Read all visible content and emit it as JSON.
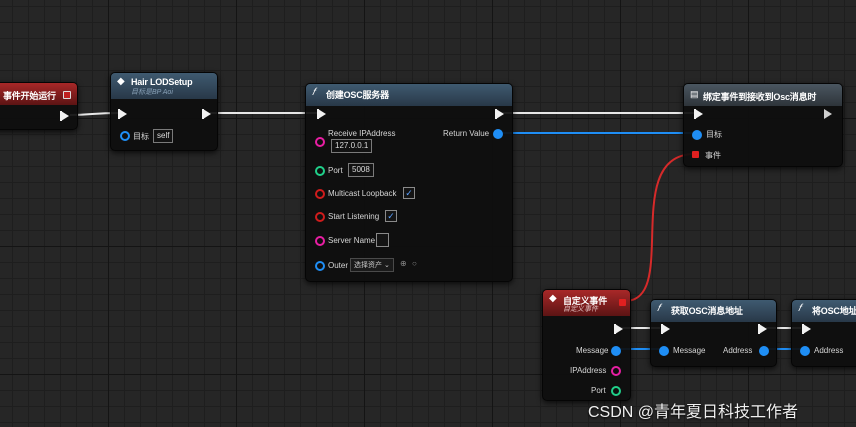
{
  "nodes": {
    "begin_play": {
      "title": "事件开始运行"
    },
    "hair_lod": {
      "title": "Hair LODSetup",
      "subtitle": "目标是BP Aoi",
      "target_label": "目标",
      "target_value": "self"
    },
    "create_osc": {
      "title": "创建OSC服务器",
      "receive_ip_label": "Receive IPAddress",
      "receive_ip_value": "127.0.0.1",
      "port_label": "Port",
      "port_value": "5008",
      "multicast_label": "Multicast Loopback",
      "multicast_checked": "✓",
      "start_listening_label": "Start Listening",
      "start_listening_checked": "✓",
      "server_name_label": "Server Name",
      "outer_label": "Outer",
      "outer_value": "选择资产",
      "return_label": "Return Value"
    },
    "bind_event": {
      "title": "绑定事件到接收到Osc消息时",
      "target_label": "目标",
      "event_label": "事件"
    },
    "custom_event": {
      "title": "自定义事件",
      "subtitle": "自定义事件",
      "message_label": "Message",
      "ip_label": "IPAddress",
      "port_label": "Port"
    },
    "get_osc_address": {
      "title": "获取OSC消息地址",
      "message_label": "Message",
      "address_label": "Address"
    },
    "to_osc_address": {
      "title": "将OSC地址",
      "address_label": "Address"
    }
  },
  "watermark": "CSDN @青年夏日科技工作者",
  "colors": {
    "exec_wire": "#e8e8e8",
    "object_wire": "#1f8ef5",
    "delegate_wire": "#d62a2a"
  }
}
